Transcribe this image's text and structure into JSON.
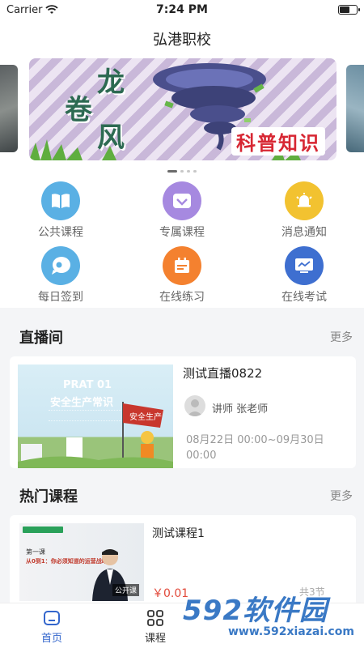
{
  "status_bar": {
    "carrier": "Carrier",
    "time": "7:24 PM"
  },
  "header": {
    "title": "弘港职校"
  },
  "banner": {
    "chars": [
      "龙",
      "卷",
      "风"
    ],
    "caption": "科普知识"
  },
  "menu": {
    "items": [
      {
        "label": "公共课程",
        "icon": "book-icon",
        "color": "#5ab0e4"
      },
      {
        "label": "专属课程",
        "icon": "diamond-icon",
        "color": "#a689e0"
      },
      {
        "label": "消息通知",
        "icon": "bell-icon",
        "color": "#f2c230"
      },
      {
        "label": "每日签到",
        "icon": "chat-icon",
        "color": "#5ab0e4"
      },
      {
        "label": "在线练习",
        "icon": "calendar-icon",
        "color": "#f4812f"
      },
      {
        "label": "在线考试",
        "icon": "monitor-icon",
        "color": "#3e6fd0"
      }
    ]
  },
  "live": {
    "section_title": "直播间",
    "more": "更多",
    "card": {
      "thumb_title": "PRAT 01",
      "thumb_subtitle": "安全生产常识",
      "flag_text": "安全生产",
      "title": "测试直播0822",
      "teacher": "讲师 张老师",
      "date": "08月22日 00:00~09月30日 00:00"
    }
  },
  "hot": {
    "section_title": "热门课程",
    "more": "更多",
    "card": {
      "thumb_lesson": "第一课",
      "thumb_hook": "从0到1：你必须知道的运营战略",
      "thumb_open": "公开课",
      "title": "测试课程1",
      "price": "￥0.01",
      "count": "共3节"
    }
  },
  "tabbar": {
    "tabs": [
      {
        "label": "首页",
        "icon": "home-icon"
      },
      {
        "label": "课程",
        "icon": "grid-icon"
      }
    ]
  },
  "watermark": {
    "text": "592软件园",
    "url": "www.592xiazai.com"
  },
  "colors": {
    "accent": "#3366cc",
    "price": "#e24a3b"
  }
}
